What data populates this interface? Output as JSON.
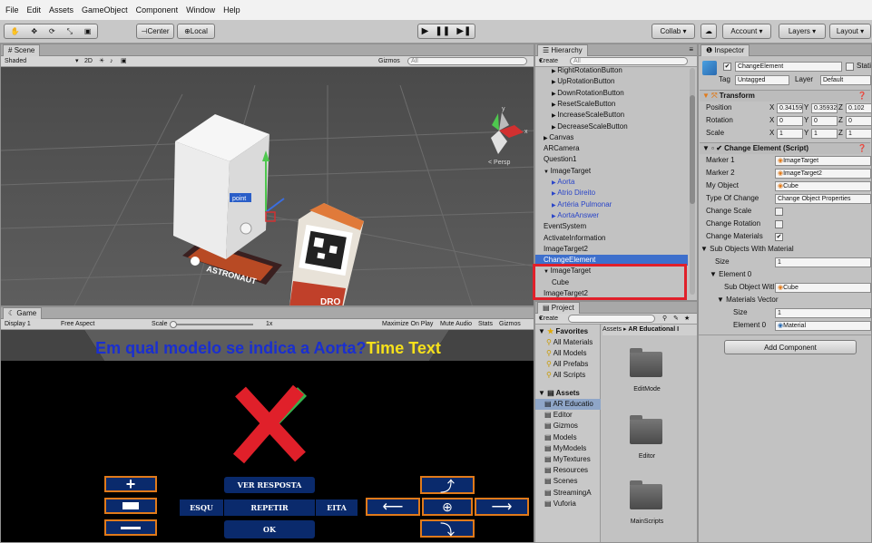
{
  "menu": [
    "File",
    "Edit",
    "Assets",
    "GameObject",
    "Component",
    "Window",
    "Help"
  ],
  "toolbar": {
    "pivot": "Center",
    "space": "Local",
    "collab": "Collab",
    "account": "Account",
    "layers": "Layers",
    "layout": "Layout"
  },
  "scene": {
    "tab": "Scene",
    "shading": "Shaded",
    "mode2d": "2D",
    "gizmos": "Gizmos",
    "search": "All",
    "persp": "Persp",
    "point_label": "point",
    "card1_text": "ASTRONAUT",
    "card2_text": "DRO",
    "gizmo_y": "y",
    "gizmo_x": "x"
  },
  "game": {
    "tab": "Game",
    "display": "Display 1",
    "aspect": "Free Aspect",
    "scale_label": "Scale",
    "scale_value": "1x",
    "toggles": [
      "Maximize On Play",
      "Mute Audio",
      "Stats",
      "Gizmos"
    ],
    "question": "Em qual modelo se indica a Aorta?",
    "time_text": "Time Text",
    "btn_ver": "VER RESPOSTA",
    "btn_esq": "ESQU",
    "btn_repetir": "REPETIR",
    "btn_dir": "EITA",
    "btn_ok": "OK"
  },
  "hierarchy": {
    "tab": "Hierarchy",
    "create": "Create",
    "search": "All",
    "items": [
      {
        "label": "RightRotationButton",
        "indent": 2,
        "arrow": "▶",
        "blue": false
      },
      {
        "label": "UpRotationButton",
        "indent": 2,
        "arrow": "▶",
        "blue": false
      },
      {
        "label": "DownRotationButton",
        "indent": 2,
        "arrow": "▶",
        "blue": false
      },
      {
        "label": "ResetScaleButton",
        "indent": 2,
        "arrow": "▶",
        "blue": false
      },
      {
        "label": "IncreaseScaleButton",
        "indent": 2,
        "arrow": "▶",
        "blue": false
      },
      {
        "label": "DecreaseScaleButton",
        "indent": 2,
        "arrow": "▶",
        "blue": false
      },
      {
        "label": "Canvas",
        "indent": 1,
        "arrow": "▶",
        "blue": false
      },
      {
        "label": "ARCamera",
        "indent": 1,
        "arrow": "",
        "blue": false
      },
      {
        "label": "Question1",
        "indent": 1,
        "arrow": "",
        "blue": false
      },
      {
        "label": "ImageTarget",
        "indent": 1,
        "arrow": "▼",
        "blue": false
      },
      {
        "label": "Aorta",
        "indent": 2,
        "arrow": "▶",
        "blue": true
      },
      {
        "label": "Atrio Direito",
        "indent": 2,
        "arrow": "▶",
        "blue": true
      },
      {
        "label": "Artéria Pulmonar",
        "indent": 2,
        "arrow": "▶",
        "blue": true
      },
      {
        "label": "AortaAnswer",
        "indent": 2,
        "arrow": "▶",
        "blue": true
      },
      {
        "label": "EventSystem",
        "indent": 1,
        "arrow": "",
        "blue": false
      },
      {
        "label": "ActivateInformation",
        "indent": 1,
        "arrow": "",
        "blue": false
      },
      {
        "label": "ImageTarget2",
        "indent": 1,
        "arrow": "",
        "blue": false
      },
      {
        "label": "ChangeElement",
        "indent": 1,
        "arrow": "",
        "blue": false,
        "selected": true
      },
      {
        "label": "ImageTarget",
        "indent": 1,
        "arrow": "▼",
        "blue": false
      },
      {
        "label": "Cube",
        "indent": 2,
        "arrow": "",
        "blue": false
      },
      {
        "label": "ImageTarget2",
        "indent": 1,
        "arrow": "",
        "blue": false
      }
    ]
  },
  "project": {
    "tab": "Project",
    "create": "Create",
    "favorites_label": "Favorites",
    "favorites": [
      "All Materials",
      "All Models",
      "All Prefabs",
      "All Scripts"
    ],
    "assets_label": "Assets",
    "assets": [
      {
        "label": "AR Educatio",
        "selected": true
      },
      {
        "label": "Editor",
        "selected": false
      },
      {
        "label": "Gizmos",
        "selected": false
      },
      {
        "label": "Models",
        "selected": false
      },
      {
        "label": "MyModels",
        "selected": false
      },
      {
        "label": "MyTextures",
        "selected": false
      },
      {
        "label": "Resources",
        "selected": false
      },
      {
        "label": "Scenes",
        "selected": false
      },
      {
        "label": "StreamingA",
        "selected": false
      },
      {
        "label": "Vuforia",
        "selected": false
      }
    ],
    "breadcrumb_root": "Assets",
    "breadcrumb_child": "AR Educational I",
    "folders": [
      "EditMode",
      "Editor",
      "MainScripts"
    ]
  },
  "inspector": {
    "tab": "Inspector",
    "object_name": "ChangeElement",
    "static_label": "Static",
    "tag_label": "Tag",
    "tag_value": "Untagged",
    "layer_label": "Layer",
    "layer_value": "Default",
    "transform": {
      "title": "Transform",
      "rows": [
        {
          "label": "Position",
          "x": "0.34159",
          "y": "0.35932",
          "z": "0.102"
        },
        {
          "label": "Rotation",
          "x": "0",
          "y": "0",
          "z": "0"
        },
        {
          "label": "Scale",
          "x": "1",
          "y": "1",
          "z": "1"
        }
      ]
    },
    "script": {
      "title": "Change Element (Script)",
      "marker1_label": "Marker 1",
      "marker1": "ImageTarget",
      "marker2_label": "Marker 2",
      "marker2": "ImageTarget2",
      "myobject_label": "My Object",
      "myobject": "Cube",
      "type_label": "Type Of Change",
      "type_value": "Change Object Properties",
      "change_scale": "Change Scale",
      "change_rotation": "Change Rotation",
      "change_materials": "Change Materials",
      "sub_objects": "Sub Objects With Material",
      "size_label": "Size",
      "size_value": "1",
      "element0": "Element 0",
      "sub_object_label": "Sub Object Witl",
      "sub_object_value": "Cube",
      "materials_vector": "Materials Vector",
      "mat_size_label": "Size",
      "mat_size_value": "1",
      "mat_element_label": "Element 0",
      "mat_element_value": "Material"
    },
    "add_component": "Add Component"
  },
  "colors": {
    "accent_red": "#e0202a",
    "game_blue": "#1a2fd0",
    "time_yellow": "#f7e11a",
    "button_navy": "#0a2a6c",
    "button_orange": "#e07a1a"
  }
}
